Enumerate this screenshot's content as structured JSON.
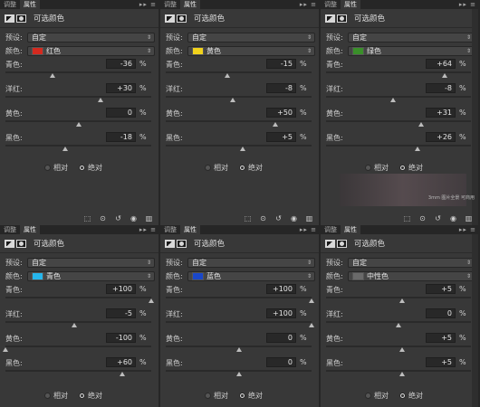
{
  "common": {
    "tab_adjust": "调整",
    "tab_props": "属性",
    "tab_controls": "▸▸ ≡",
    "title": "可选颜色",
    "preset_label": "预设:",
    "preset_value": "自定",
    "color_label": "颜色:",
    "cyan_label": "青色:",
    "magenta_label": "洋红:",
    "yellow_label": "黄色:",
    "black_label": "黑色:",
    "pct": "%",
    "relative": "相对",
    "absolute": "绝对",
    "mode": "absolute"
  },
  "panels": [
    {
      "color_name": "红色",
      "swatch": "#d42a1f",
      "cyan": "-36",
      "magenta": "+30",
      "yellow": "0",
      "black": "-18",
      "cyan_level": -36,
      "magenta_level": 30,
      "yellow_level": 0,
      "black_level": -18
    },
    {
      "color_name": "黄色",
      "swatch": "#f1d21c",
      "cyan": "-15",
      "magenta": "-8",
      "yellow": "+50",
      "black": "+5",
      "cyan_level": -15,
      "magenta_level": -8,
      "yellow_level": 50,
      "black_level": 5
    },
    {
      "color_name": "绿色",
      "swatch": "#3a8f2a",
      "cyan": "+64",
      "magenta": "-8",
      "yellow": "+31",
      "black": "+26",
      "cyan_level": 64,
      "magenta_level": -8,
      "yellow_level": 31,
      "black_level": 26
    },
    {
      "color_name": "青色",
      "swatch": "#26b6ec",
      "cyan": "+100",
      "magenta": "-5",
      "yellow": "-100",
      "black": "+60",
      "cyan_level": 100,
      "magenta_level": -5,
      "yellow_level": -100,
      "black_level": 60
    },
    {
      "color_name": "蓝色",
      "swatch": "#1a47c9",
      "cyan": "+100",
      "magenta": "+100",
      "yellow": "0",
      "black": "0",
      "cyan_level": 100,
      "magenta_level": 100,
      "yellow_level": 0,
      "black_level": 0
    },
    {
      "color_name": "中性色",
      "swatch": "#6a6a6a",
      "cyan": "+5",
      "magenta": "0",
      "yellow": "+5",
      "black": "+5",
      "cyan_level": 5,
      "magenta_level": 0,
      "yellow_level": 5,
      "black_level": 5
    }
  ],
  "footer_icons": [
    "clip-icon",
    "eye-cycle-icon",
    "reset-icon",
    "visibility-icon",
    "trash-icon"
  ],
  "watermark": "3mm\n图片全景 可商用"
}
